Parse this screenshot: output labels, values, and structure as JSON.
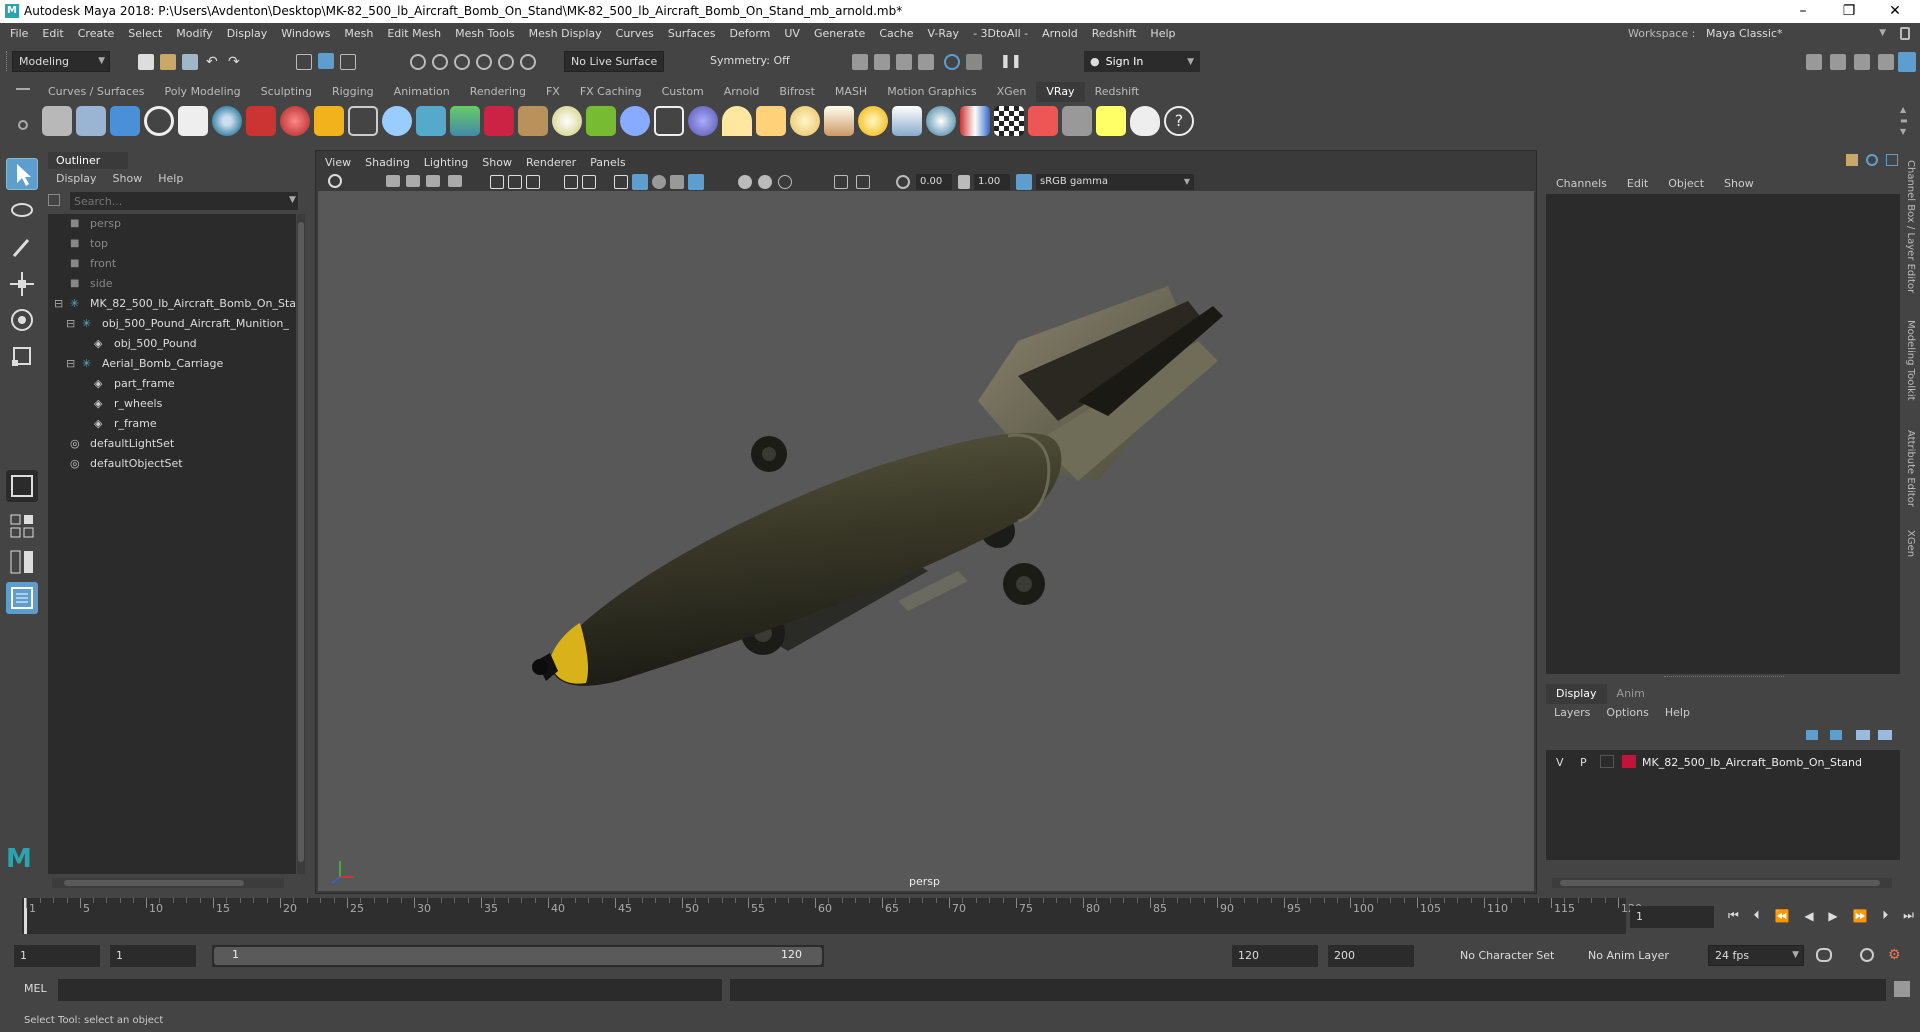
{
  "window": {
    "title": "Autodesk Maya 2018: P:\\Users\\Avdenton\\Desktop\\MK-82_500_lb_Aircraft_Bomb_On_Stand\\MK-82_500_lb_Aircraft_Bomb_On_Stand_mb_arnold.mb*",
    "logo": "M"
  },
  "menubar": {
    "items": [
      "File",
      "Edit",
      "Create",
      "Select",
      "Modify",
      "Display",
      "Windows",
      "Mesh",
      "Edit Mesh",
      "Mesh Tools",
      "Mesh Display",
      "Curves",
      "Surfaces",
      "Deform",
      "UV",
      "Generate",
      "Cache",
      "V-Ray",
      "- 3DtoAll -",
      "Arnold",
      "Redshift",
      "Help"
    ],
    "workspace_label": "Workspace :",
    "workspace_value": "Maya Classic*"
  },
  "statusline": {
    "mode": "Modeling",
    "live_surface": "No Live Surface",
    "symmetry": "Symmetry: Off",
    "sign_in": "Sign In"
  },
  "shelf": {
    "tabs": [
      "Curves / Surfaces",
      "Poly Modeling",
      "Sculpting",
      "Rigging",
      "Animation",
      "Rendering",
      "FX",
      "FX Caching",
      "Custom",
      "Arnold",
      "Bifrost",
      "MASH",
      "Motion Graphics",
      "XGen",
      "VRay",
      "Redshift"
    ],
    "active_tab": "VRay"
  },
  "outliner": {
    "title": "Outliner",
    "menu": [
      "Display",
      "Show",
      "Help"
    ],
    "search_placeholder": "Search...",
    "items": [
      {
        "label": "persp",
        "indent": 0,
        "icon": "camera-icon",
        "dim": true
      },
      {
        "label": "top",
        "indent": 0,
        "icon": "camera-icon",
        "dim": true
      },
      {
        "label": "front",
        "indent": 0,
        "icon": "camera-icon",
        "dim": true
      },
      {
        "label": "side",
        "indent": 0,
        "icon": "camera-icon",
        "dim": true
      },
      {
        "label": "MK_82_500_lb_Aircraft_Bomb_On_Sta",
        "indent": 0,
        "icon": "group-icon",
        "dim": false
      },
      {
        "label": "obj_500_Pound_Aircraft_Munition_",
        "indent": 1,
        "icon": "group-icon",
        "dim": false
      },
      {
        "label": "obj_500_Pound",
        "indent": 2,
        "icon": "mesh-icon",
        "dim": false
      },
      {
        "label": "Aerial_Bomb_Carriage",
        "indent": 1,
        "icon": "group-icon",
        "dim": false
      },
      {
        "label": "part_frame",
        "indent": 2,
        "icon": "mesh-icon",
        "dim": false
      },
      {
        "label": "r_wheels",
        "indent": 2,
        "icon": "mesh-icon",
        "dim": false
      },
      {
        "label": "r_frame",
        "indent": 2,
        "icon": "mesh-icon",
        "dim": false
      },
      {
        "label": "defaultLightSet",
        "indent": 0,
        "icon": "set-icon",
        "dim": false
      },
      {
        "label": "defaultObjectSet",
        "indent": 0,
        "icon": "set-icon",
        "dim": false
      }
    ]
  },
  "viewport": {
    "menu": [
      "View",
      "Shading",
      "Lighting",
      "Show",
      "Renderer",
      "Panels"
    ],
    "exposure": "0.00",
    "gamma": "1.00",
    "color_space": "sRGB gamma",
    "camera_label": "persp"
  },
  "channelbox": {
    "menu": [
      "Channels",
      "Edit",
      "Object",
      "Show"
    ],
    "side_tabs": [
      "Channel Box / Layer Editor",
      "Modeling Toolkit",
      "Attribute Editor",
      "XGen"
    ]
  },
  "layereditor": {
    "tabs": [
      "Display",
      "Anim"
    ],
    "active_tab": "Display",
    "menu": [
      "Layers",
      "Options",
      "Help"
    ],
    "layer": {
      "v": "V",
      "p": "P",
      "name": "MK_82_500_lb_Aircraft_Bomb_On_Stand",
      "color": "#c0143c"
    }
  },
  "timeline": {
    "ticks": [
      "1",
      "5",
      "10",
      "15",
      "20",
      "25",
      "30",
      "35",
      "40",
      "45",
      "50",
      "55",
      "60",
      "65",
      "70",
      "75",
      "80",
      "85",
      "90",
      "95",
      "100",
      "105",
      "110",
      "115",
      "120"
    ],
    "current_frame": "1"
  },
  "range": {
    "start": "1",
    "playback_start": "1",
    "slider_start": "1",
    "slider_end": "120",
    "playback_end": "120",
    "end": "200",
    "character_set": "No Character Set",
    "anim_layer": "No Anim Layer",
    "fps": "24 fps"
  },
  "commandline": {
    "label": "MEL"
  },
  "helpline": {
    "text": "Select Tool: select an object"
  },
  "colors": {
    "accent": "#5d9ecf",
    "layer_color": "#c0143c",
    "viewport_bg": "#585858"
  }
}
